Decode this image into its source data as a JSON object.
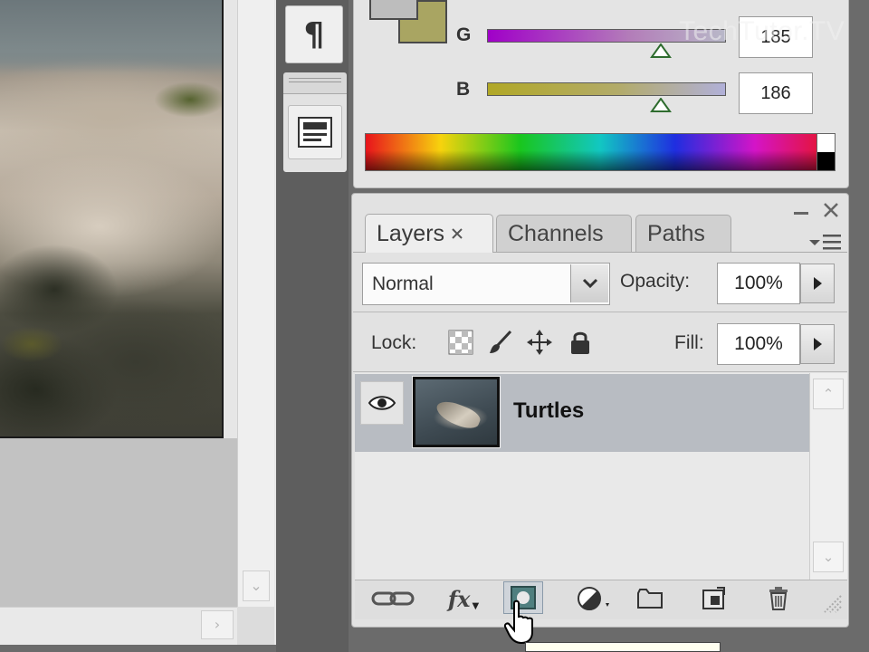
{
  "color_panel": {
    "channels": [
      {
        "label": "G",
        "value": "185"
      },
      {
        "label": "B",
        "value": "186"
      }
    ],
    "watermark": "TechTutor.TV"
  },
  "layers_panel": {
    "tabs": [
      {
        "label": "Layers",
        "active": true,
        "closable": true
      },
      {
        "label": "Channels",
        "active": false
      },
      {
        "label": "Paths",
        "active": false
      }
    ],
    "blend_mode": "Normal",
    "opacity_label": "Opacity:",
    "opacity_value": "100%",
    "lock_label": "Lock:",
    "fill_label": "Fill:",
    "fill_value": "100%",
    "layers": [
      {
        "name": "Turtles",
        "visible": true,
        "selected": true
      }
    ],
    "footer_icons": [
      "link-layers-icon",
      "fx-icon",
      "add-mask-icon",
      "adjustment-layer-icon",
      "new-group-icon",
      "new-layer-icon",
      "trash-icon"
    ],
    "fx_label": "fx"
  },
  "dock": {
    "icons": [
      "paragraph-icon",
      "character-panel-icon"
    ],
    "paragraph_glyph": "¶"
  },
  "colors": {
    "panel_bg": "#e2e2e2",
    "selected_row": "#b8bcc2",
    "background_swatch": "#a9a562"
  }
}
